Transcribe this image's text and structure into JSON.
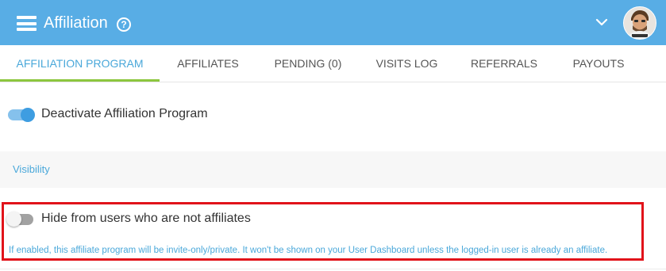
{
  "header": {
    "title": "Affiliation",
    "help_glyph": "?",
    "menu_icon": "hamburger-menu-icon",
    "account_icon": "chevron-down-icon",
    "bg_color": "#58ade5"
  },
  "tabs": [
    {
      "label": "AFFILIATION PROGRAM",
      "active": true
    },
    {
      "label": "AFFILIATES",
      "active": false
    },
    {
      "label": "PENDING (0)",
      "active": false
    },
    {
      "label": "VISITS LOG",
      "active": false
    },
    {
      "label": "REFERRALS",
      "active": false
    },
    {
      "label": "PAYOUTS",
      "active": false
    }
  ],
  "deactivate": {
    "label": "Deactivate Affiliation Program",
    "enabled": true
  },
  "visibility": {
    "section_title": "Visibility",
    "hide_label": "Hide from users who are not affiliates",
    "hide_enabled": false,
    "help_text": "If enabled, this affiliate program will be invite-only/private. It won't be shown on your User Dashboard unless the logged-in user is already an affiliate."
  },
  "colors": {
    "accent": "#4aa8da",
    "active_tab_underline": "#8cc63e",
    "highlight_border": "#e1131a"
  }
}
